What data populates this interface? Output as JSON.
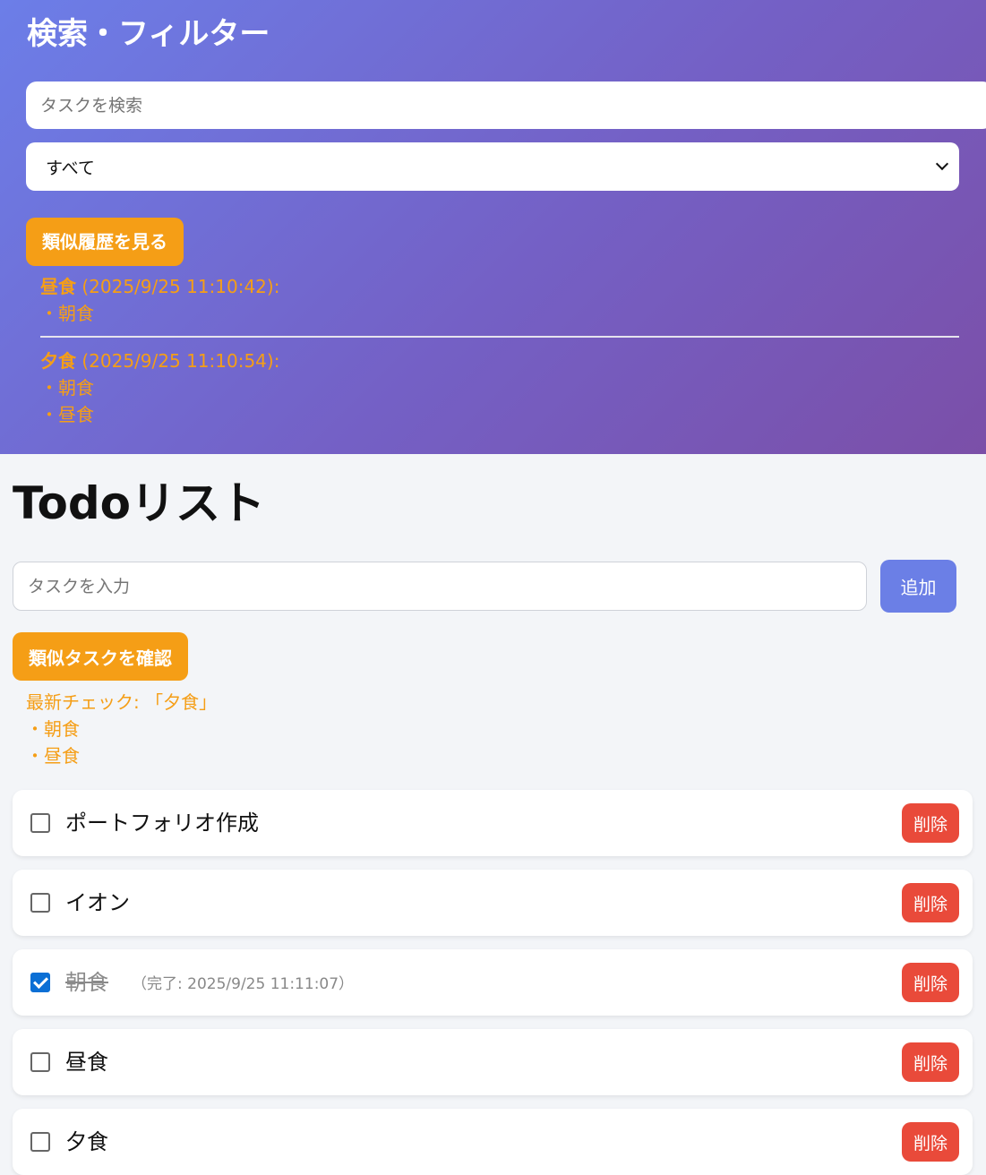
{
  "filter": {
    "title": "検索・フィルター",
    "search_placeholder": "タスクを検索",
    "select_value": "すべて",
    "history_button": "類似履歴を見る",
    "history": [
      {
        "name": "昼食",
        "time": " (2025/9/25 11:10:42):",
        "items": [
          "・朝食"
        ]
      },
      {
        "name": "夕食",
        "time": " (2025/9/25 11:10:54):",
        "items": [
          "・朝食",
          "・昼食"
        ]
      }
    ]
  },
  "todo": {
    "title": "Todoリスト",
    "input_placeholder": "タスクを入力",
    "add_button": "追加",
    "similar_button": "類似タスクを確認",
    "latest_check": {
      "label": "最新チェック: 「夕食」",
      "items": [
        "・朝食",
        "・昼食"
      ]
    },
    "delete_label": "削除",
    "items": [
      {
        "text": "ポートフォリオ作成",
        "checked": false,
        "completed": ""
      },
      {
        "text": "イオン",
        "checked": false,
        "completed": ""
      },
      {
        "text": "朝食",
        "checked": true,
        "completed": "（完了: 2025/9/25 11:11:07）"
      },
      {
        "text": "昼食",
        "checked": false,
        "completed": ""
      },
      {
        "text": "夕食",
        "checked": false,
        "completed": ""
      }
    ]
  },
  "colors": {
    "accent_orange": "#f59e16",
    "primary_blue": "#6b7fe6",
    "delete_red": "#e94a3a",
    "check_blue": "#0b6fd5"
  }
}
